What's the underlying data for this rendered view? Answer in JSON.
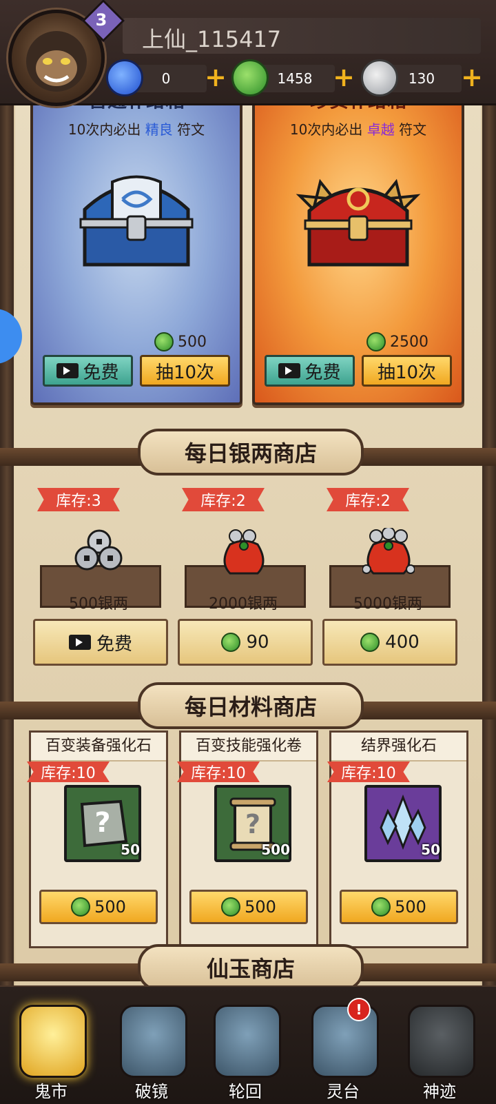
{
  "header": {
    "level": "3",
    "player_name": "上仙_115417",
    "resources": [
      {
        "icon": "blue-gem-icon",
        "value": "0"
      },
      {
        "icon": "jade-coin-icon",
        "value": "1458"
      },
      {
        "icon": "silver-coin-icon",
        "value": "130"
      }
    ]
  },
  "supply": {
    "common": {
      "title": "普通补给箱",
      "sub_prefix": "10次内必出",
      "sub_highlight": "精良",
      "sub_suffix": "符文",
      "price": "500",
      "free_label": "免费",
      "draw_label": "抽10次"
    },
    "rare": {
      "title": "珍贵补给箱",
      "sub_prefix": "10次内必出",
      "sub_highlight": "卓越",
      "sub_suffix": "符文",
      "price": "2500",
      "free_label": "免费",
      "draw_label": "抽10次"
    }
  },
  "silver_shop": {
    "title": "每日银两商店",
    "items": [
      {
        "stock": "库存:3",
        "label": "500银两",
        "price_label": "免费"
      },
      {
        "stock": "库存:2",
        "label": "2000银两",
        "price_label": "90"
      },
      {
        "stock": "库存:2",
        "label": "5000银两",
        "price_label": "400"
      }
    ]
  },
  "material_shop": {
    "title": "每日材料商店",
    "items": [
      {
        "name": "百变装备强化石",
        "stock": "库存:10",
        "qty": "50",
        "price": "500"
      },
      {
        "name": "百变技能强化卷",
        "stock": "库存:10",
        "qty": "500",
        "price": "500"
      },
      {
        "name": "结界强化石",
        "stock": "库存:10",
        "qty": "50",
        "price": "500"
      }
    ]
  },
  "jade_shop": {
    "title": "仙玉商店"
  },
  "nav": [
    {
      "label": "鬼市",
      "active": true
    },
    {
      "label": "破镜"
    },
    {
      "label": "轮回"
    },
    {
      "label": "灵台",
      "badge": "!"
    },
    {
      "label": "神迹"
    }
  ]
}
